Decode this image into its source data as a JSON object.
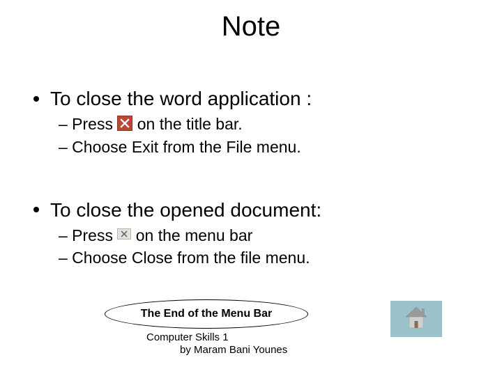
{
  "title": "Note",
  "section1": {
    "heading": "To close the word application :",
    "item1_a": "– Press ",
    "item1_b": " on the title bar.",
    "item2": "– Choose Exit from the File menu."
  },
  "section2": {
    "heading": "To close the opened document:",
    "item1_a": "– Press ",
    "item1_b": " on the menu bar",
    "item2": "– Choose Close from the file menu."
  },
  "endOval": "The End of the Menu Bar",
  "footer": {
    "line1": "Computer Skills 1",
    "line2": "by Maram Bani Younes"
  }
}
